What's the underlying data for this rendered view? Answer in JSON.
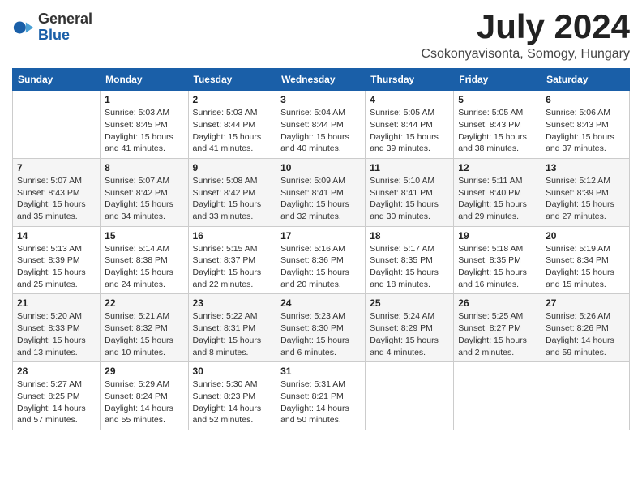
{
  "logo": {
    "general": "General",
    "blue": "Blue"
  },
  "header": {
    "month": "July 2024",
    "location": "Csokonyavisonta, Somogy, Hungary"
  },
  "weekdays": [
    "Sunday",
    "Monday",
    "Tuesday",
    "Wednesday",
    "Thursday",
    "Friday",
    "Saturday"
  ],
  "weeks": [
    [
      {
        "day": null
      },
      {
        "day": "1",
        "sunrise": "5:03 AM",
        "sunset": "8:45 PM",
        "daylight": "15 hours and 41 minutes."
      },
      {
        "day": "2",
        "sunrise": "5:03 AM",
        "sunset": "8:44 PM",
        "daylight": "15 hours and 41 minutes."
      },
      {
        "day": "3",
        "sunrise": "5:04 AM",
        "sunset": "8:44 PM",
        "daylight": "15 hours and 40 minutes."
      },
      {
        "day": "4",
        "sunrise": "5:05 AM",
        "sunset": "8:44 PM",
        "daylight": "15 hours and 39 minutes."
      },
      {
        "day": "5",
        "sunrise": "5:05 AM",
        "sunset": "8:43 PM",
        "daylight": "15 hours and 38 minutes."
      },
      {
        "day": "6",
        "sunrise": "5:06 AM",
        "sunset": "8:43 PM",
        "daylight": "15 hours and 37 minutes."
      }
    ],
    [
      {
        "day": "7",
        "sunrise": "5:07 AM",
        "sunset": "8:43 PM",
        "daylight": "15 hours and 35 minutes."
      },
      {
        "day": "8",
        "sunrise": "5:07 AM",
        "sunset": "8:42 PM",
        "daylight": "15 hours and 34 minutes."
      },
      {
        "day": "9",
        "sunrise": "5:08 AM",
        "sunset": "8:42 PM",
        "daylight": "15 hours and 33 minutes."
      },
      {
        "day": "10",
        "sunrise": "5:09 AM",
        "sunset": "8:41 PM",
        "daylight": "15 hours and 32 minutes."
      },
      {
        "day": "11",
        "sunrise": "5:10 AM",
        "sunset": "8:41 PM",
        "daylight": "15 hours and 30 minutes."
      },
      {
        "day": "12",
        "sunrise": "5:11 AM",
        "sunset": "8:40 PM",
        "daylight": "15 hours and 29 minutes."
      },
      {
        "day": "13",
        "sunrise": "5:12 AM",
        "sunset": "8:39 PM",
        "daylight": "15 hours and 27 minutes."
      }
    ],
    [
      {
        "day": "14",
        "sunrise": "5:13 AM",
        "sunset": "8:39 PM",
        "daylight": "15 hours and 25 minutes."
      },
      {
        "day": "15",
        "sunrise": "5:14 AM",
        "sunset": "8:38 PM",
        "daylight": "15 hours and 24 minutes."
      },
      {
        "day": "16",
        "sunrise": "5:15 AM",
        "sunset": "8:37 PM",
        "daylight": "15 hours and 22 minutes."
      },
      {
        "day": "17",
        "sunrise": "5:16 AM",
        "sunset": "8:36 PM",
        "daylight": "15 hours and 20 minutes."
      },
      {
        "day": "18",
        "sunrise": "5:17 AM",
        "sunset": "8:35 PM",
        "daylight": "15 hours and 18 minutes."
      },
      {
        "day": "19",
        "sunrise": "5:18 AM",
        "sunset": "8:35 PM",
        "daylight": "15 hours and 16 minutes."
      },
      {
        "day": "20",
        "sunrise": "5:19 AM",
        "sunset": "8:34 PM",
        "daylight": "15 hours and 15 minutes."
      }
    ],
    [
      {
        "day": "21",
        "sunrise": "5:20 AM",
        "sunset": "8:33 PM",
        "daylight": "15 hours and 13 minutes."
      },
      {
        "day": "22",
        "sunrise": "5:21 AM",
        "sunset": "8:32 PM",
        "daylight": "15 hours and 10 minutes."
      },
      {
        "day": "23",
        "sunrise": "5:22 AM",
        "sunset": "8:31 PM",
        "daylight": "15 hours and 8 minutes."
      },
      {
        "day": "24",
        "sunrise": "5:23 AM",
        "sunset": "8:30 PM",
        "daylight": "15 hours and 6 minutes."
      },
      {
        "day": "25",
        "sunrise": "5:24 AM",
        "sunset": "8:29 PM",
        "daylight": "15 hours and 4 minutes."
      },
      {
        "day": "26",
        "sunrise": "5:25 AM",
        "sunset": "8:27 PM",
        "daylight": "15 hours and 2 minutes."
      },
      {
        "day": "27",
        "sunrise": "5:26 AM",
        "sunset": "8:26 PM",
        "daylight": "14 hours and 59 minutes."
      }
    ],
    [
      {
        "day": "28",
        "sunrise": "5:27 AM",
        "sunset": "8:25 PM",
        "daylight": "14 hours and 57 minutes."
      },
      {
        "day": "29",
        "sunrise": "5:29 AM",
        "sunset": "8:24 PM",
        "daylight": "14 hours and 55 minutes."
      },
      {
        "day": "30",
        "sunrise": "5:30 AM",
        "sunset": "8:23 PM",
        "daylight": "14 hours and 52 minutes."
      },
      {
        "day": "31",
        "sunrise": "5:31 AM",
        "sunset": "8:21 PM",
        "daylight": "14 hours and 50 minutes."
      },
      {
        "day": null
      },
      {
        "day": null
      },
      {
        "day": null
      }
    ]
  ],
  "labels": {
    "sunrise": "Sunrise:",
    "sunset": "Sunset:",
    "daylight": "Daylight:"
  }
}
